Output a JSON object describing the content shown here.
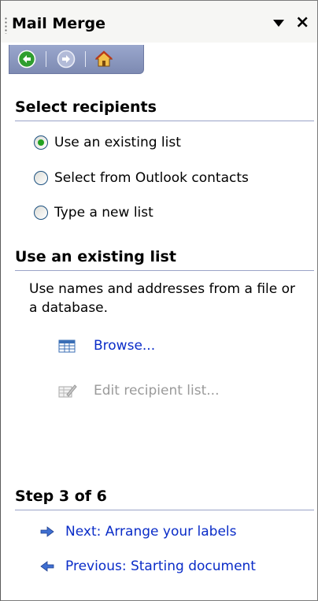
{
  "pane": {
    "title": "Mail Merge",
    "menu_icon": "dropdown-triangle-icon",
    "close_label": "×"
  },
  "navigation": {
    "back_icon": "back-arrow-icon",
    "forward_icon": "forward-arrow-icon",
    "home_icon": "home-icon"
  },
  "select_recipients": {
    "heading": "Select recipients",
    "options": [
      {
        "label": "Use an existing list",
        "selected": true
      },
      {
        "label": "Select from Outlook contacts",
        "selected": false
      },
      {
        "label": "Type a new list",
        "selected": false
      }
    ]
  },
  "existing_list": {
    "heading": "Use an existing list",
    "description": "Use names and addresses from a file or a database.",
    "browse_label": "Browse...",
    "edit_label": "Edit recipient list..."
  },
  "step": {
    "heading": "Step 3 of 6",
    "next_label": "Next: Arrange your labels",
    "previous_label": "Previous: Starting document"
  },
  "colors": {
    "link": "#0a2cc8",
    "disabled": "#9a9a9a",
    "nav_bar": "#8c98c1"
  }
}
